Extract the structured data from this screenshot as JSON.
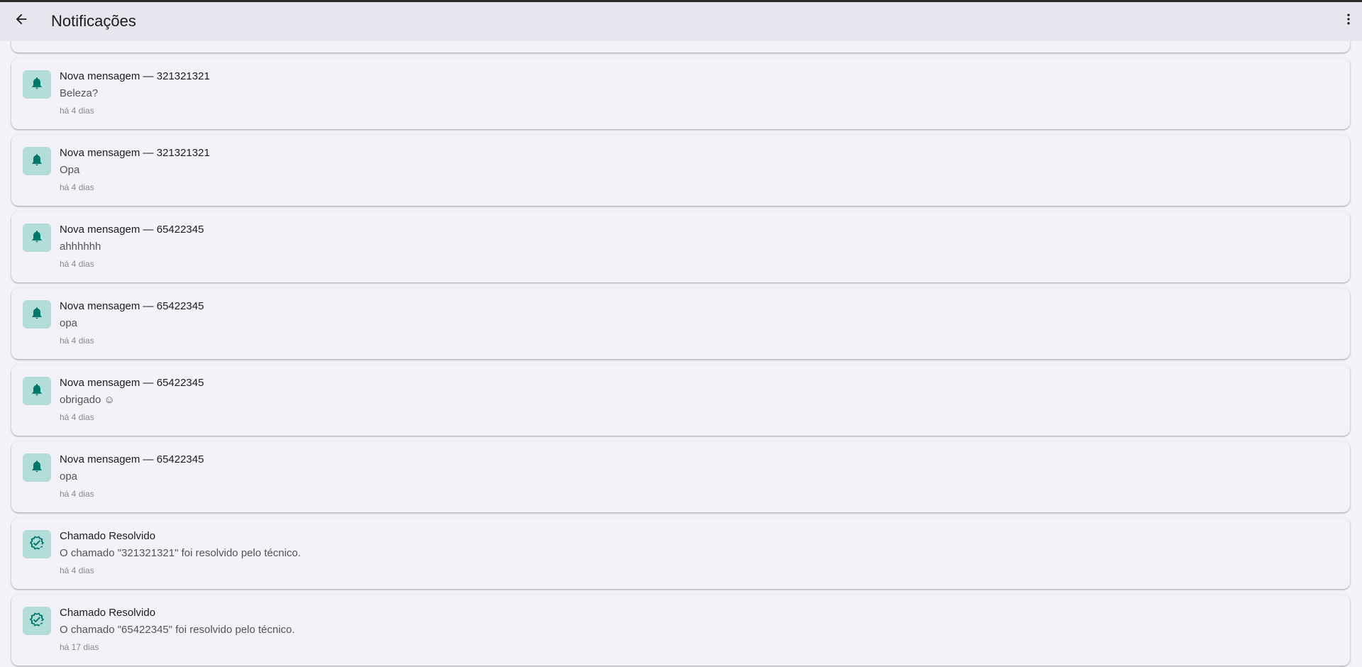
{
  "appbar": {
    "title": "Notificações",
    "back_icon": "arrow-back-icon",
    "menu_icon": "more-vert-icon"
  },
  "colors": {
    "appbar_bg": "#e6e6ef",
    "card_bg": "#f3f2f9",
    "icon_bg": "#b3ddd9",
    "icon_fg": "#00796b"
  },
  "notifications": [
    {
      "icon": "bell-icon",
      "title": "Nova mensagem — 321321321",
      "body": "Beleza?",
      "time": "há 4 dias"
    },
    {
      "icon": "bell-icon",
      "title": "Nova mensagem — 321321321",
      "body": "Opa",
      "time": "há 4 dias"
    },
    {
      "icon": "bell-icon",
      "title": "Nova mensagem — 65422345",
      "body": "ahhhhhh",
      "time": "há 4 dias"
    },
    {
      "icon": "bell-icon",
      "title": "Nova mensagem — 65422345",
      "body": "opa",
      "time": "há 4 dias"
    },
    {
      "icon": "bell-icon",
      "title": "Nova mensagem — 65422345",
      "body": "obrigado ☺",
      "time": "há 4 dias"
    },
    {
      "icon": "bell-icon",
      "title": "Nova mensagem — 65422345",
      "body": "opa",
      "time": "há 4 dias"
    },
    {
      "icon": "verified-check-icon",
      "title": "Chamado Resolvido",
      "body": "O chamado \"321321321\" foi resolvido pelo técnico.",
      "time": "há 4 dias"
    },
    {
      "icon": "verified-check-icon",
      "title": "Chamado Resolvido",
      "body": "O chamado \"65422345\" foi resolvido pelo técnico.",
      "time": "há 17 dias"
    }
  ]
}
